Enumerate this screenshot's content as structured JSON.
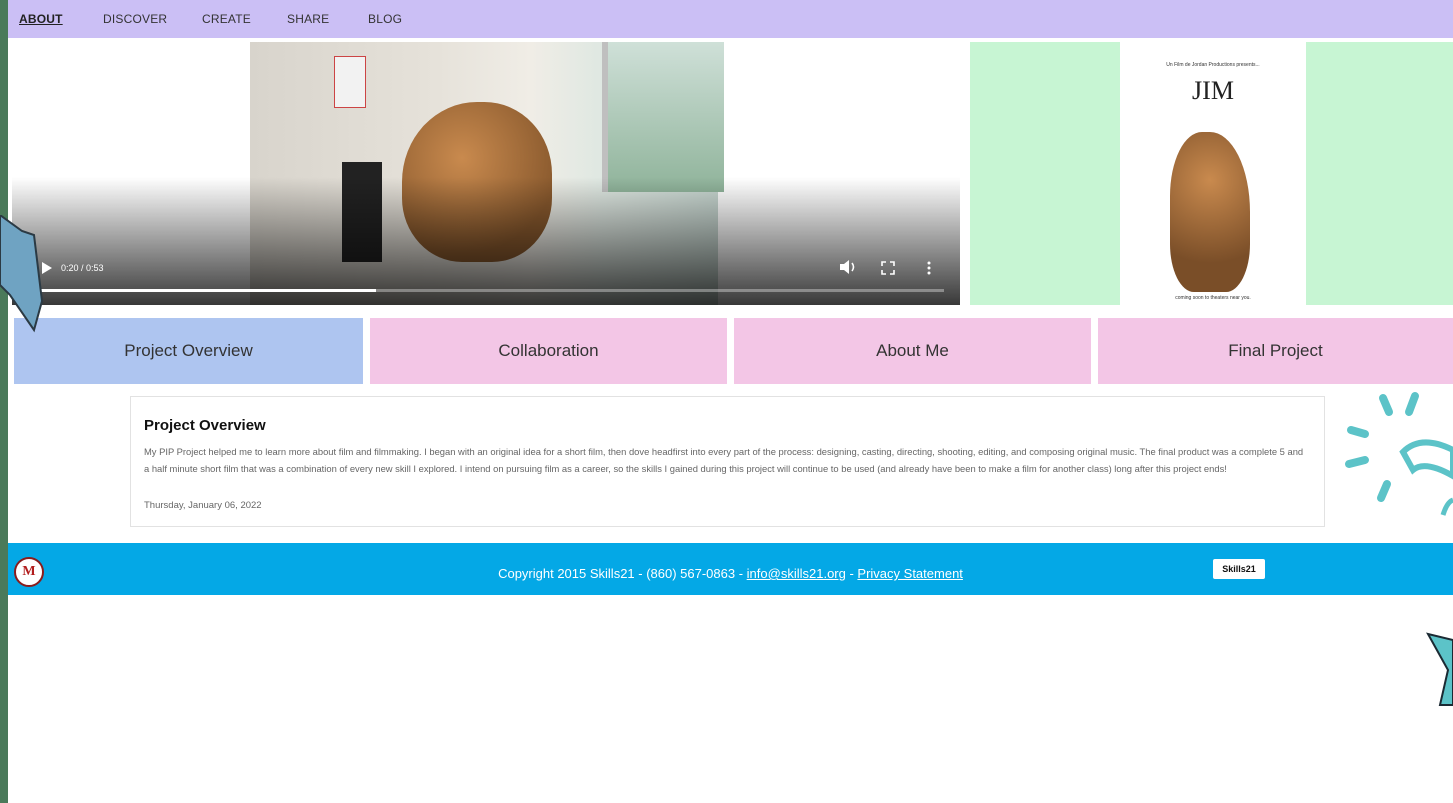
{
  "colors": {
    "nav_bg": "#cbbff5",
    "tab_active": "#aec5f0",
    "tab_inactive": "#f3c6e6",
    "poster_bg": "#c7f5d3",
    "footer_bg": "#04a8e6",
    "border": "#4a7a5a"
  },
  "nav": {
    "items": [
      {
        "label": "ABOUT",
        "active": true
      },
      {
        "label": "DISCOVER",
        "active": false
      },
      {
        "label": "CREATE",
        "active": false
      },
      {
        "label": "SHARE",
        "active": false
      },
      {
        "label": "BLOG",
        "active": false
      }
    ]
  },
  "video": {
    "time": "0:20 / 0:53",
    "progress_fraction": 0.38,
    "icons": [
      "play-icon",
      "volume-icon",
      "fullscreen-icon",
      "more-options-icon"
    ]
  },
  "poster": {
    "presents": "Un Film de Jordan Productions presents...",
    "title": "JIM",
    "tagline": "coming soon to theaters near you."
  },
  "tabs": [
    {
      "label": "Project Overview",
      "active": true
    },
    {
      "label": "Collaboration",
      "active": false
    },
    {
      "label": "About Me",
      "active": false
    },
    {
      "label": "Final Project",
      "active": false
    }
  ],
  "card": {
    "title": "Project Overview",
    "body": "My PIP Project helped me to learn more about film and filmmaking. I began with an original idea for a short film, then dove headfirst into every part of the process: designing, casting, directing, shooting, editing, and composing original music. The final product was a complete 5 and a half minute short film that was a combination of every new skill I explored. I intend on pursuing film as a career, so the skills I gained during this project will continue to be used (and already have been to make a film for another class) long after this project ends!",
    "date": "Thursday, January 06, 2022"
  },
  "footer": {
    "copyright": "Copyright 2015 Skills21 - (860) 567-0863 - ",
    "email": "info@skills21.org",
    "separator": " - ",
    "privacy": "Privacy Statement",
    "seal_letter": "M",
    "logo_text": "Skills21"
  }
}
